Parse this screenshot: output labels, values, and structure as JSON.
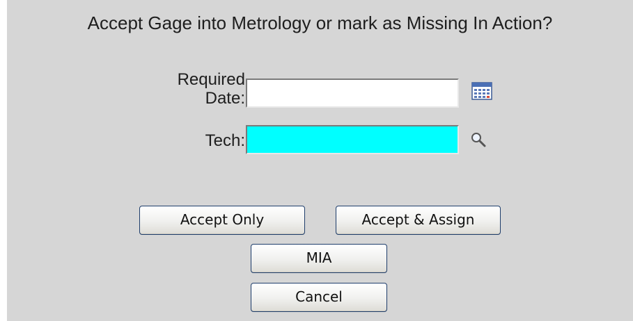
{
  "dialog": {
    "title": "Accept Gage into Metrology or mark as Missing In Action?"
  },
  "form": {
    "required_date": {
      "label_line1": "Required",
      "label_line2": "Date:",
      "value": "",
      "icon": "calendar-icon"
    },
    "tech": {
      "label": "Tech:",
      "value": "",
      "icon": "magnifier-icon",
      "background": "#00ffff"
    }
  },
  "buttons": {
    "accept_only": "Accept Only",
    "accept_assign": "Accept & Assign",
    "mia": "MIA",
    "cancel": "Cancel"
  },
  "colors": {
    "panel_bg": "#d6d6d6",
    "button_border": "#1e3d6b"
  }
}
